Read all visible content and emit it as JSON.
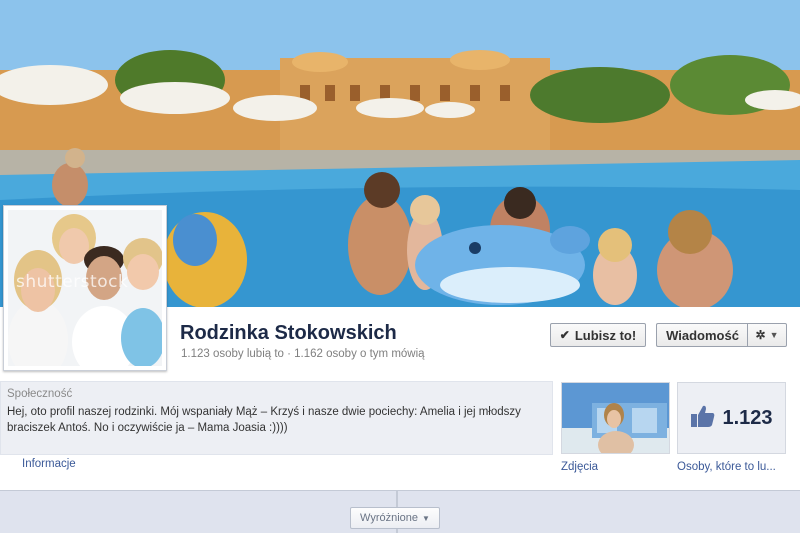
{
  "page": {
    "name": "Rodzinka Stokowskich",
    "stats": "1.123 osoby lubią to · 1.162 osoby o tym mówią"
  },
  "actions": {
    "like_label": "Lubisz to!",
    "message_label": "Wiadomość"
  },
  "profile_picture": {
    "watermark": "shutterstock"
  },
  "about": {
    "category": "Społeczność",
    "text": "Hej, oto profil naszej rodzinki. Mój wspaniały Mąż – Krzyś i nasze dwie pociechy: Amelia i jej młodszy braciszek Antoś. No i oczywiście ja – Mama Joasia :))))",
    "info_link": "Informacje"
  },
  "apps": {
    "photos_label": "Zdjęcia",
    "likes_count": "1.123",
    "likes_label": "Osoby, które to lu..."
  },
  "timeline": {
    "highlights_label": "Wyróżnione"
  },
  "icons": {
    "like_check": "check-icon",
    "settings": "gear-icon",
    "thumbs_up": "thumbs-up-icon",
    "dropdown": "caret-down-icon"
  },
  "colors": {
    "link": "#3b5998",
    "title": "#1d2a47",
    "panel": "#edeff4"
  }
}
